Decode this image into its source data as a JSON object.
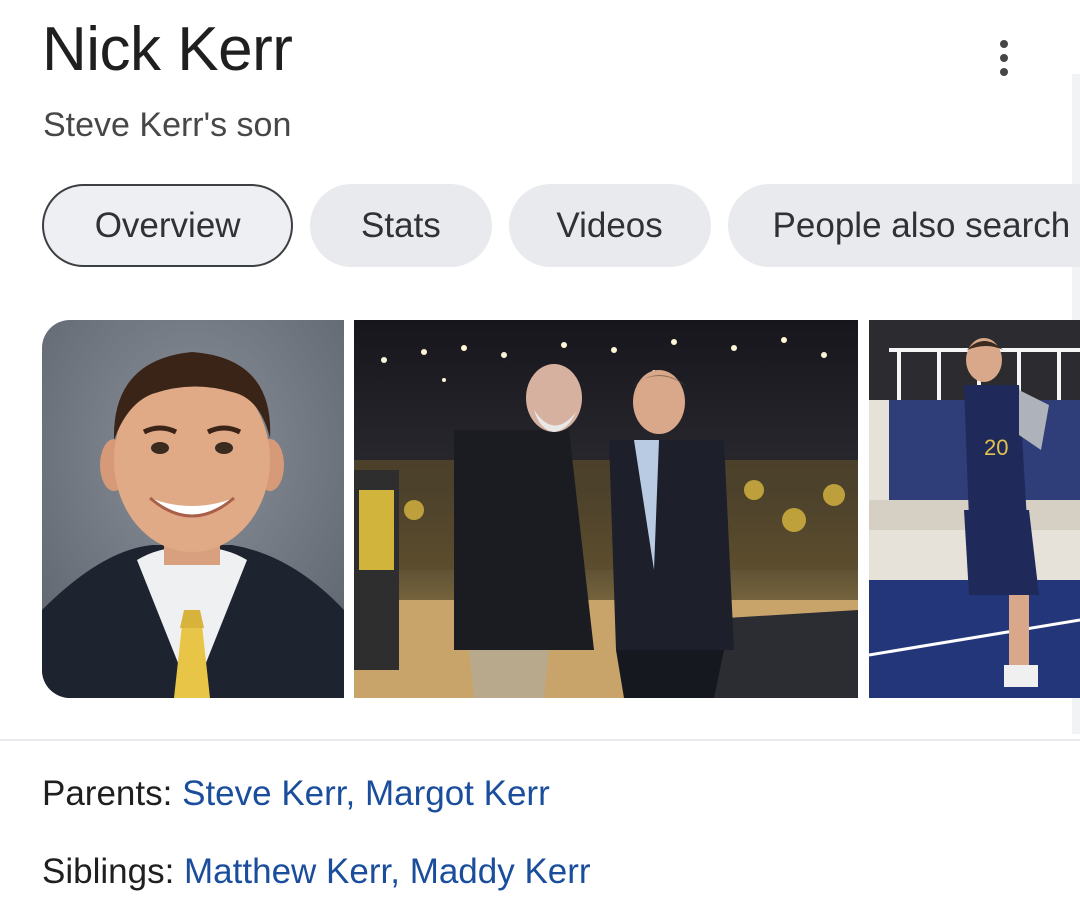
{
  "header": {
    "title": "Nick Kerr",
    "subtitle": "Steve Kerr's son"
  },
  "tabs": [
    {
      "label": "Overview",
      "active": true
    },
    {
      "label": "Stats",
      "active": false
    },
    {
      "label": "Videos",
      "active": false
    },
    {
      "label": "People also search for",
      "active": false
    }
  ],
  "images": [
    {
      "description": "headshot"
    },
    {
      "description": "arena"
    },
    {
      "description": "practice"
    }
  ],
  "facts": {
    "parents": {
      "label": "Parents:",
      "links": [
        "Steve Kerr",
        "Margot Kerr"
      ],
      "separator": ", "
    },
    "siblings": {
      "label": "Siblings:",
      "links": [
        "Matthew Kerr",
        "Maddy Kerr"
      ],
      "separator": ", "
    }
  },
  "icons": {
    "more": "more-vert-icon"
  },
  "colors": {
    "link": "#1a4e9c",
    "chip_bg": "#e9eaed",
    "chip_border": "#3c4043"
  }
}
